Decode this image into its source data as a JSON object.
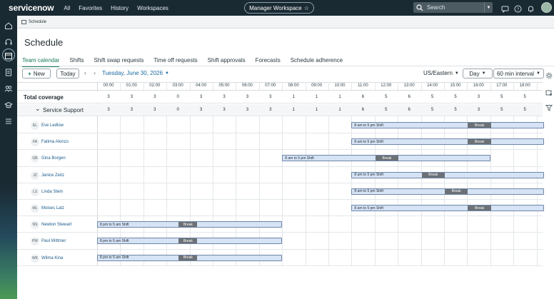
{
  "topnav": {
    "logo": "servicenow",
    "links": [
      "All",
      "Favorites",
      "History",
      "Workspaces"
    ],
    "workspace": "Manager Workspace",
    "search_placeholder": "Search",
    "icons": [
      "search-icon",
      "chat-icon",
      "help-icon",
      "bell-icon",
      "avatar"
    ]
  },
  "rail": {
    "icons": [
      "home-icon",
      "headset-icon",
      "calendar-icon",
      "clipboard-icon",
      "team-icon",
      "graduation-icon",
      "list-icon"
    ]
  },
  "tabstrip": {
    "tab": "Schedule"
  },
  "page": {
    "title": "Schedule",
    "subtabs": [
      "Team calendar",
      "Shifts",
      "Shift swap requests",
      "Time off requests",
      "Shift approvals",
      "Forecasts",
      "Schedule adherence"
    ],
    "active_subtab": 0
  },
  "toolbar": {
    "new_label": "New",
    "today_label": "Today",
    "date": "Tuesday, June 30, 2026",
    "timezone": "US/Eastern",
    "view": "Day",
    "interval": "60 min interval"
  },
  "grid": {
    "hours": [
      "00:00",
      "01:00",
      "02:00",
      "03:00",
      "04:00",
      "05:00",
      "06:00",
      "07:00",
      "08:00",
      "09:00",
      "10:00",
      "11:00",
      "12:00",
      "13:00",
      "14:00",
      "15:00",
      "16:00",
      "17:00",
      "18:00"
    ],
    "total_coverage": {
      "label": "Total coverage",
      "values": [
        "3",
        "3",
        "3",
        "0",
        "3",
        "3",
        "3",
        "3",
        "1",
        "1",
        "1",
        "6",
        "5",
        "6",
        "5",
        "5",
        "3",
        "5",
        "5"
      ]
    },
    "group": {
      "label": "Service Support",
      "values": [
        "3",
        "3",
        "3",
        "0",
        "3",
        "3",
        "3",
        "3",
        "1",
        "1",
        "1",
        "6",
        "5",
        "6",
        "5",
        "5",
        "3",
        "5",
        "5"
      ]
    },
    "agents": [
      {
        "initials": "EL",
        "name": "Eve Ledlow",
        "shift_label": "8 am to 5 pm Shift",
        "break_label": "Break",
        "shift_start": 11,
        "shift_end": 20,
        "break_start": 16,
        "break_end": 17
      },
      {
        "initials": "FA",
        "name": "Fatima Alonzo",
        "shift_label": "8 am to 5 pm Shift",
        "break_label": "Break",
        "shift_start": 11,
        "shift_end": 20,
        "break_start": 16,
        "break_end": 17
      },
      {
        "initials": "GB",
        "name": "Gina Borgen",
        "shift_label": "8 am to 5 pm Shift",
        "break_label": "Break",
        "shift_start": 8,
        "shift_end": 17,
        "break_start": 12,
        "break_end": 13
      },
      {
        "initials": "JZ",
        "name": "Janice Zeitz",
        "shift_label": "8 am to 5 pm Shift",
        "break_label": "Break",
        "shift_start": 11,
        "shift_end": 20,
        "break_start": 14,
        "break_end": 15
      },
      {
        "initials": "LS",
        "name": "Linda Stein",
        "shift_label": "8 am to 5 pm Shift",
        "break_label": "Break",
        "shift_start": 11,
        "shift_end": 20,
        "break_start": 15,
        "break_end": 16
      },
      {
        "initials": "ML",
        "name": "Moises Latz",
        "shift_label": "8 am to 5 pm Shift",
        "break_label": "Break",
        "shift_start": 11,
        "shift_end": 20,
        "break_start": 16,
        "break_end": 17
      },
      {
        "initials": "NS",
        "name": "Newton Stewart",
        "shift_label": "8 pm to 5 am Shift",
        "break_label": "Break",
        "shift_start": 0,
        "shift_end": 8,
        "break_start": 3.5,
        "break_end": 4.3
      },
      {
        "initials": "PW",
        "name": "Paul Wittmer",
        "shift_label": "8 pm to 5 am Shift",
        "break_label": "Break",
        "shift_start": 0,
        "shift_end": 8,
        "break_start": 3.5,
        "break_end": 4.3
      },
      {
        "initials": "WK",
        "name": "Wilma Kina",
        "shift_label": "8 pm to 5 am Shift",
        "break_label": "Break",
        "shift_start": 0,
        "shift_end": 8,
        "break_start": 3.5,
        "break_end": 4.3
      }
    ]
  },
  "colors": {
    "nav_bg": "#1a2a33",
    "accent": "#1a7a5a",
    "shift_fill": "#d6e3f5",
    "break_fill": "#6b7176",
    "link": "#1a5a8a"
  }
}
